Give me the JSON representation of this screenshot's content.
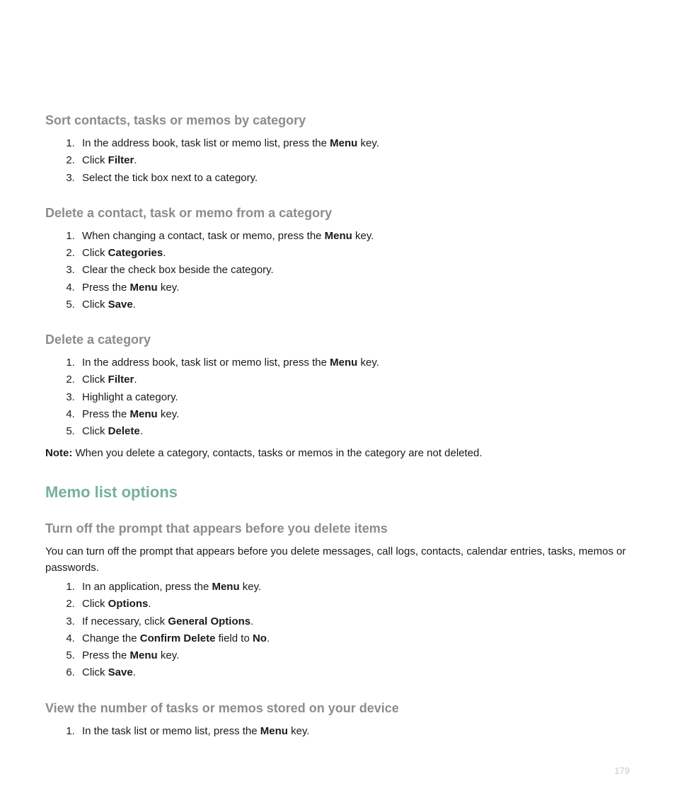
{
  "sec1": {
    "heading": "Sort contacts, tasks or memos by category",
    "steps": [
      [
        {
          "t": "In the address book, task list or memo list, press the "
        },
        {
          "t": "Menu",
          "b": true
        },
        {
          "t": " key."
        }
      ],
      [
        {
          "t": "Click "
        },
        {
          "t": "Filter",
          "b": true
        },
        {
          "t": "."
        }
      ],
      [
        {
          "t": "Select the tick box next to a category."
        }
      ]
    ]
  },
  "sec2": {
    "heading": "Delete a contact, task or memo from a category",
    "steps": [
      [
        {
          "t": "When changing a contact, task or memo, press the "
        },
        {
          "t": "Menu",
          "b": true
        },
        {
          "t": " key."
        }
      ],
      [
        {
          "t": "Click "
        },
        {
          "t": "Categories",
          "b": true
        },
        {
          "t": "."
        }
      ],
      [
        {
          "t": "Clear the check box beside the category."
        }
      ],
      [
        {
          "t": "Press the "
        },
        {
          "t": "Menu",
          "b": true
        },
        {
          "t": " key."
        }
      ],
      [
        {
          "t": "Click "
        },
        {
          "t": "Save",
          "b": true
        },
        {
          "t": "."
        }
      ]
    ]
  },
  "sec3": {
    "heading": "Delete a category",
    "steps": [
      [
        {
          "t": "In the address book, task list or memo list, press the "
        },
        {
          "t": "Menu",
          "b": true
        },
        {
          "t": " key."
        }
      ],
      [
        {
          "t": "Click "
        },
        {
          "t": "Filter",
          "b": true
        },
        {
          "t": "."
        }
      ],
      [
        {
          "t": "Highlight a category."
        }
      ],
      [
        {
          "t": "Press the "
        },
        {
          "t": "Menu",
          "b": true
        },
        {
          "t": " key."
        }
      ],
      [
        {
          "t": "Click "
        },
        {
          "t": "Delete",
          "b": true
        },
        {
          "t": "."
        }
      ]
    ],
    "note": [
      {
        "t": "Note:",
        "b": true
      },
      {
        "t": " When you delete a category, contacts, tasks or memos in the category are not deleted."
      }
    ]
  },
  "sec4": {
    "heading": "Memo list options"
  },
  "sec5": {
    "heading": "Turn off the prompt that appears before you delete items",
    "intro": [
      {
        "t": "You can turn off the prompt that appears before you delete messages, call logs, contacts, calendar entries, tasks, memos or passwords."
      }
    ],
    "steps": [
      [
        {
          "t": "In an application, press the "
        },
        {
          "t": "Menu",
          "b": true
        },
        {
          "t": " key."
        }
      ],
      [
        {
          "t": "Click "
        },
        {
          "t": "Options",
          "b": true
        },
        {
          "t": "."
        }
      ],
      [
        {
          "t": "If necessary, click "
        },
        {
          "t": "General Options",
          "b": true
        },
        {
          "t": "."
        }
      ],
      [
        {
          "t": "Change the "
        },
        {
          "t": "Confirm Delete",
          "b": true
        },
        {
          "t": " field to "
        },
        {
          "t": "No",
          "b": true
        },
        {
          "t": "."
        }
      ],
      [
        {
          "t": "Press the "
        },
        {
          "t": "Menu",
          "b": true
        },
        {
          "t": " key."
        }
      ],
      [
        {
          "t": "Click "
        },
        {
          "t": "Save",
          "b": true
        },
        {
          "t": "."
        }
      ]
    ]
  },
  "sec6": {
    "heading": "View the number of tasks or memos stored on your device",
    "steps": [
      [
        {
          "t": "In the task list or memo list, press the "
        },
        {
          "t": "Menu",
          "b": true
        },
        {
          "t": " key."
        }
      ]
    ]
  },
  "pagenum": "179"
}
